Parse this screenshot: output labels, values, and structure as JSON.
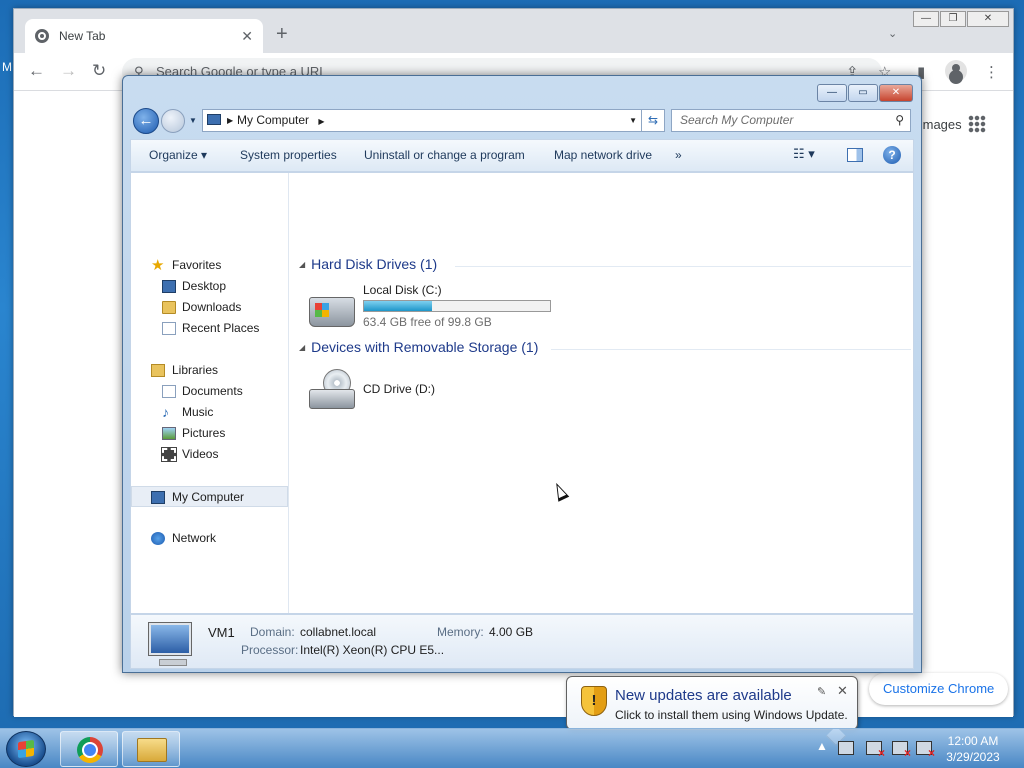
{
  "chrome": {
    "tab_title": "New Tab",
    "tab_close": "✕",
    "new_tab": "+",
    "tab_search": "⌄",
    "minimize": "—",
    "restore": "❐",
    "close": "✕",
    "omnibox_placeholder": "Search Google or type a URL",
    "images_link": "Images",
    "customize_label": "Customize Chrome"
  },
  "explorer": {
    "minimize": "—",
    "maximize": "▭",
    "close": "✕",
    "breadcrumb": "My Computer",
    "search_placeholder": "Search My Computer",
    "commands": {
      "organize": "Organize ▾",
      "system_properties": "System properties",
      "uninstall": "Uninstall or change a program",
      "map_drive": "Map network drive",
      "more": "»"
    },
    "nav": {
      "favorites": "Favorites",
      "desktop": "Desktop",
      "downloads": "Downloads",
      "recent_places": "Recent Places",
      "libraries": "Libraries",
      "documents": "Documents",
      "music": "Music",
      "pictures": "Pictures",
      "videos": "Videos",
      "my_computer": "My Computer",
      "network": "Network"
    },
    "groups": {
      "hdd_header": "Hard Disk Drives (1)",
      "removable_header": "Devices with Removable Storage (1)"
    },
    "drives": {
      "c_name": "Local Disk (C:)",
      "c_free": "63.4 GB free of 99.8 GB",
      "c_used_fraction": 0.365,
      "d_name": "CD Drive (D:)"
    },
    "details": {
      "name": "VM1",
      "domain_label": "Domain:",
      "domain_value": "collabnet.local",
      "memory_label": "Memory:",
      "memory_value": "4.00 GB",
      "processor_label": "Processor:",
      "processor_value": "Intel(R) Xeon(R) CPU E5..."
    }
  },
  "notification": {
    "title": "New updates are available",
    "text": "Click to install them using Windows Update.",
    "close": "✕"
  },
  "taskbar": {
    "time": "12:00 AM",
    "date": "3/29/2023"
  }
}
